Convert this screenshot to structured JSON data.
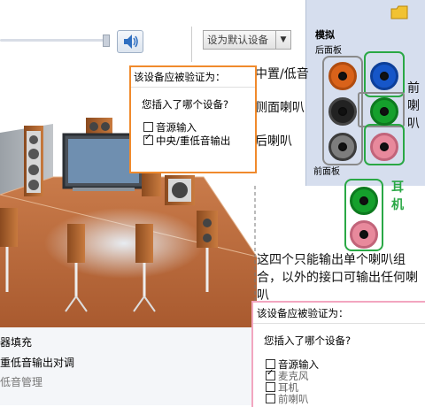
{
  "toolbar": {
    "set_default_label": "设为默认设备",
    "dropdown_arrow": "▼",
    "speaker_icon": "speaker-volume-icon"
  },
  "bottom_list": {
    "item1": "器填充",
    "item2": "重低音输出对调",
    "item3": "低音管理"
  },
  "panel": {
    "title": "模拟",
    "rear_label": "后面板",
    "front_label": "前面板",
    "jack_colors": {
      "orange": "#d9621a",
      "blue": "#1656c8",
      "black": "#222222",
      "green": "#15a02c",
      "gray": "#7d7d7d",
      "pink": "#e8899c"
    }
  },
  "popup1": {
    "header": "该设备应被验证为：",
    "question": "您插入了哪个设备?",
    "options": [
      {
        "label": "音源输入",
        "checked": false
      },
      {
        "label": "中央/重低音输出",
        "checked": true
      }
    ]
  },
  "popup2": {
    "header": "该设备应被验证为：",
    "question": "您插入了哪个设备?",
    "options": [
      {
        "label": "音源输入",
        "checked": false
      },
      {
        "label": "麦克风",
        "checked": true
      },
      {
        "label": "耳机",
        "checked": false
      },
      {
        "label": "前喇叭",
        "checked": false
      }
    ]
  },
  "annotations": {
    "center_sub": "中置/低音",
    "side": "侧面喇叭",
    "rear": "后喇叭",
    "front": "前喇叭",
    "headphone": "耳机",
    "note": "这四个只能输出单个喇叭组合，以外的接口可输出任何喇叭"
  },
  "colors": {
    "orange_frame": "#f08a2c",
    "green_frame": "#2aa845",
    "pink_frame": "#f2a6c0",
    "gray_frame": "#8a8a8a"
  }
}
